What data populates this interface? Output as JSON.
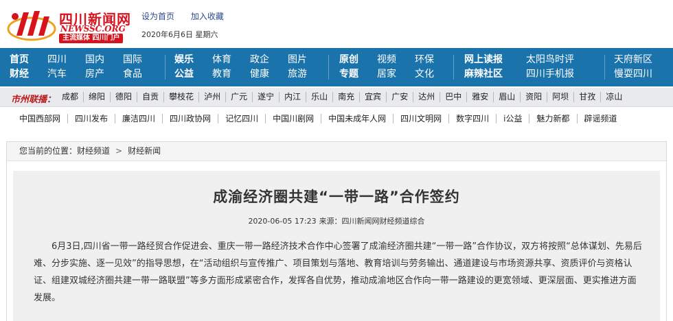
{
  "header": {
    "logo_name": "四川新闻网",
    "logo_domain": "NEWSSC.ORG",
    "logo_slogan": "主流媒体 四川门户",
    "links": [
      "设为首页",
      "加入收藏"
    ],
    "date": "2020年6月6日  星期六"
  },
  "nav": {
    "groups": [
      {
        "row1": [
          "首页",
          "四川",
          "国内",
          "国际"
        ],
        "row2": [
          "财经",
          "汽车",
          "房产",
          "食品"
        ],
        "bold_first": true
      },
      {
        "row1": [
          "娱乐",
          "体育",
          "政企",
          "图片"
        ],
        "row2": [
          "公益",
          "教育",
          "健康",
          "旅游"
        ],
        "bold_first": true
      },
      {
        "row1": [
          "原创",
          "视频",
          "环保"
        ],
        "row2": [
          "专题",
          "居家",
          "文化"
        ],
        "bold_first": true
      },
      {
        "row1": [
          "网上读报",
          "太阳鸟时评"
        ],
        "row2": [
          "麻辣社区",
          "四川手机报"
        ],
        "bold_first": true
      },
      {
        "row1": [
          "天府新区"
        ],
        "row2": [
          "慢耍四川"
        ],
        "bold_first": false
      }
    ]
  },
  "citybar": {
    "label": "市州联播：",
    "cities": [
      "成都",
      "绵阳",
      "德阳",
      "自贡",
      "攀枝花",
      "泸州",
      "广元",
      "遂宁",
      "内江",
      "乐山",
      "南充",
      "宜宾",
      "广安",
      "达州",
      "巴中",
      "雅安",
      "眉山",
      "资阳",
      "阿坝",
      "甘孜",
      "凉山"
    ]
  },
  "sitebar": {
    "sites": [
      "中国西部网",
      "四川发布",
      "廉洁四川",
      "四川政协网",
      "记忆四川",
      "中国川剧网",
      "中国未成年人网",
      "四川文明网",
      "数字四川",
      "i公益",
      "魅力新都",
      "辟谣频道"
    ]
  },
  "breadcrumb": {
    "prefix": "您当前的位置：",
    "items": [
      "财经频道",
      "财经新闻"
    ],
    "separator": ">"
  },
  "article": {
    "title": "成渝经济圈共建“一带一路”合作签约",
    "datetime": "2020-06-05 17:23",
    "source": "来源：四川新闻网财经频道综合",
    "body": "6月3日,四川省一带一路经贸合作促进会、重庆一带一路经济技术合作中心签署了成渝经济圈共建“一带一路”合作协议，双方将按照“总体谋划、先易后难、分步实施、逐一见效”的指导思想，在“活动组织与宣传推广、项目策划与落地、教育培训与劳务输出、通道建设与市场资源共享、资质评价与资格认证、组建双城经济圈共建一带一路联盟”等多方面形成紧密合作，发挥各自优势，推动成渝地区合作向一带一路建设的更宽领域、更深层面、更实推进方面发展。"
  },
  "colors": {
    "brand_red": "#d7131e",
    "nav_blue": "#1b73ac",
    "link_blue": "#2b4a8b",
    "article_bg": "#f0f0f0"
  }
}
